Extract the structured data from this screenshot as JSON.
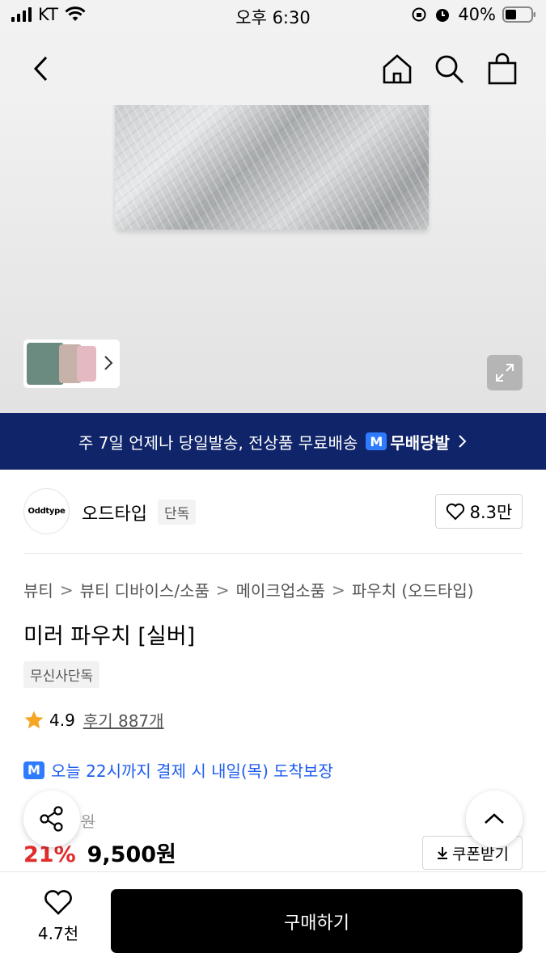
{
  "status_bar": {
    "carrier": "KT",
    "time": "오후 6:30",
    "battery": "40%"
  },
  "nav": {
    "icons": [
      "back-icon",
      "home-icon",
      "search-icon",
      "cart-icon"
    ]
  },
  "promo_banner": {
    "text": "주 7일 언제나 당일발송, 전상품 무료배송",
    "badge_logo": "M",
    "badge_label": "무배당발"
  },
  "brand": {
    "logo_text": "Oddtype",
    "name": "오드타입",
    "tag": "단독",
    "likes": "8.3만"
  },
  "breadcrumb": [
    "뷰티",
    "뷰티 디바이스/소품",
    "메이크업소품",
    "파우치 (오드타입)"
  ],
  "breadcrumb_separator": ">",
  "product": {
    "title": "미러 파우치 [실버]",
    "exclusive_badge": "무신사단독",
    "rating": "4.9",
    "reviews": "후기 887개",
    "delivery_logo": "M",
    "delivery_text": "오늘 22시까지 결제 시 내일(목) 도착보장",
    "original_price_suffix": "원",
    "discount": "21%",
    "price": "9,500원",
    "coupon_label": "쿠폰받기"
  },
  "bottom": {
    "wish_count": "4.7천",
    "buy_label": "구매하기"
  },
  "colors": {
    "banner_bg": "#0f2469",
    "discount": "#e22b2b",
    "delivery": "#1d5cf0",
    "buy_button": "#000000"
  }
}
